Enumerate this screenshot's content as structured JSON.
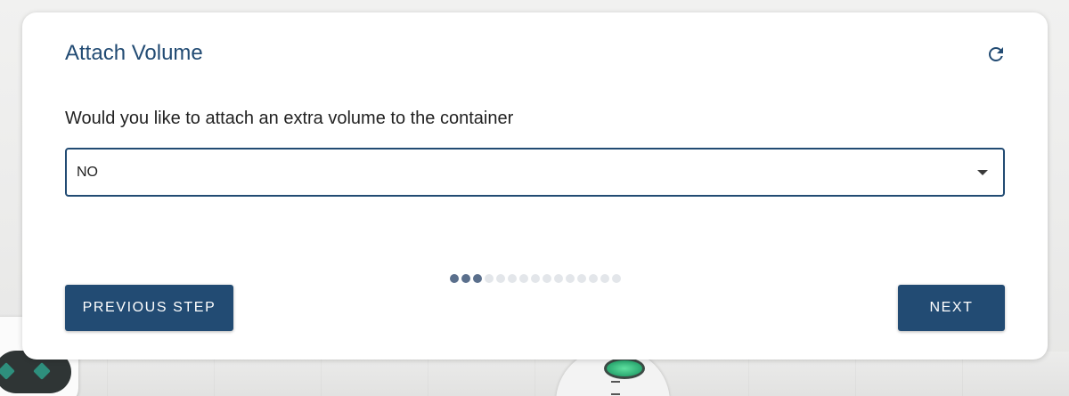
{
  "card": {
    "title": "Attach Volume",
    "refresh_icon": "refresh-icon"
  },
  "form": {
    "question": "Would you like to attach an extra volume to the container",
    "select_value": "NO",
    "dropdown_icon": "chevron-down-icon"
  },
  "stepper": {
    "total_steps": 15,
    "completed_steps": 3
  },
  "actions": {
    "previous_label": "PREVIOUS STEP",
    "next_label": "NEXT"
  },
  "colors": {
    "primary": "#224b73",
    "step_done": "#5a6f8c",
    "step_pending": "#e3e6ea"
  }
}
